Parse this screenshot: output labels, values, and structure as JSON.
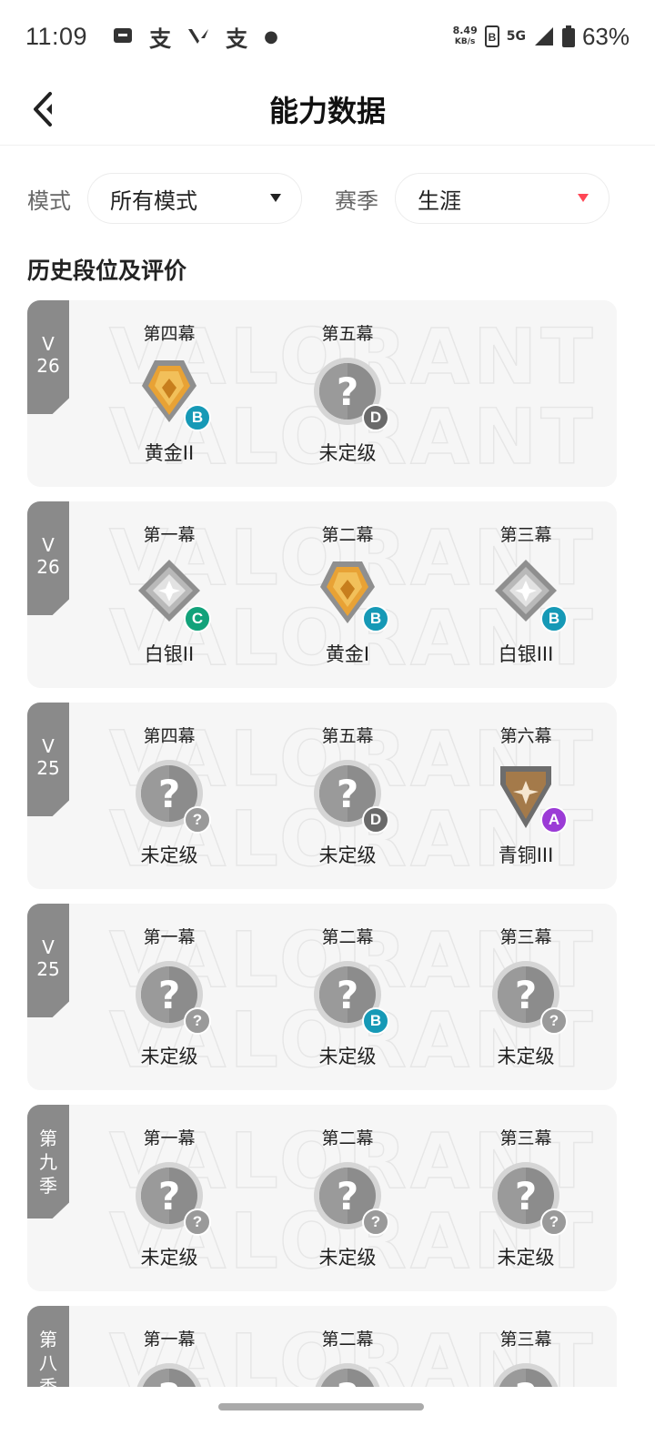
{
  "status_bar": {
    "time": "11:09",
    "notification_icons": [
      "message-icon",
      "alipay-icon",
      "valorant-icon",
      "alipay-icon",
      "dot-icon"
    ],
    "net_speed_value": "8.49",
    "net_speed_unit": "KB/s",
    "network": "5G",
    "battery": "63%"
  },
  "header": {
    "title": "能力数据",
    "back_icon": "back-arrow-icon"
  },
  "filters": {
    "mode_label": "模式",
    "mode_value": "所有模式",
    "season_label": "赛季",
    "season_value": "生涯"
  },
  "section": {
    "title": "历史段位及评价"
  },
  "watermark": {
    "line1": "VALORANT",
    "line2": "VALORANT"
  },
  "colors": {
    "ribbon": "#8a8a8a",
    "accent_red": "#ff4655",
    "grade_A": "#9b3bd6",
    "grade_B": "#1699b6",
    "grade_C": "#12a27a",
    "grade_D": "#6a6a6a",
    "grade_unknown": "#9a9a9a",
    "gold": "#e8a235",
    "silver": "#b9b9b9",
    "bronze": "#a47a4a"
  },
  "seasons": [
    {
      "tag_lines": [
        "V",
        "26"
      ],
      "acts": [
        {
          "title": "第四幕",
          "rank": "黄金II",
          "tier": "gold",
          "grade": "B"
        },
        {
          "title": "第五幕",
          "rank": "未定级",
          "tier": "unranked",
          "grade": "D"
        }
      ]
    },
    {
      "tag_lines": [
        "V",
        "26"
      ],
      "acts": [
        {
          "title": "第一幕",
          "rank": "白银II",
          "tier": "silver",
          "grade": "C"
        },
        {
          "title": "第二幕",
          "rank": "黄金I",
          "tier": "gold",
          "grade": "B"
        },
        {
          "title": "第三幕",
          "rank": "白银III",
          "tier": "silver",
          "grade": "B"
        }
      ]
    },
    {
      "tag_lines": [
        "V",
        "25"
      ],
      "acts": [
        {
          "title": "第四幕",
          "rank": "未定级",
          "tier": "unranked",
          "grade": "?"
        },
        {
          "title": "第五幕",
          "rank": "未定级",
          "tier": "unranked",
          "grade": "D"
        },
        {
          "title": "第六幕",
          "rank": "青铜III",
          "tier": "bronze",
          "grade": "A"
        }
      ]
    },
    {
      "tag_lines": [
        "V",
        "25"
      ],
      "acts": [
        {
          "title": "第一幕",
          "rank": "未定级",
          "tier": "unranked",
          "grade": "?"
        },
        {
          "title": "第二幕",
          "rank": "未定级",
          "tier": "unranked",
          "grade": "B"
        },
        {
          "title": "第三幕",
          "rank": "未定级",
          "tier": "unranked",
          "grade": "?"
        }
      ]
    },
    {
      "tag_lines": [
        "第",
        "九",
        "季"
      ],
      "acts": [
        {
          "title": "第一幕",
          "rank": "未定级",
          "tier": "unranked",
          "grade": "?"
        },
        {
          "title": "第二幕",
          "rank": "未定级",
          "tier": "unranked",
          "grade": "?"
        },
        {
          "title": "第三幕",
          "rank": "未定级",
          "tier": "unranked",
          "grade": "?"
        }
      ]
    },
    {
      "tag_lines": [
        "第",
        "八",
        "季"
      ],
      "acts": [
        {
          "title": "第一幕",
          "rank": "",
          "tier": "unranked",
          "grade": ""
        },
        {
          "title": "第二幕",
          "rank": "",
          "tier": "unranked",
          "grade": ""
        },
        {
          "title": "第三幕",
          "rank": "",
          "tier": "unranked",
          "grade": ""
        }
      ]
    }
  ]
}
